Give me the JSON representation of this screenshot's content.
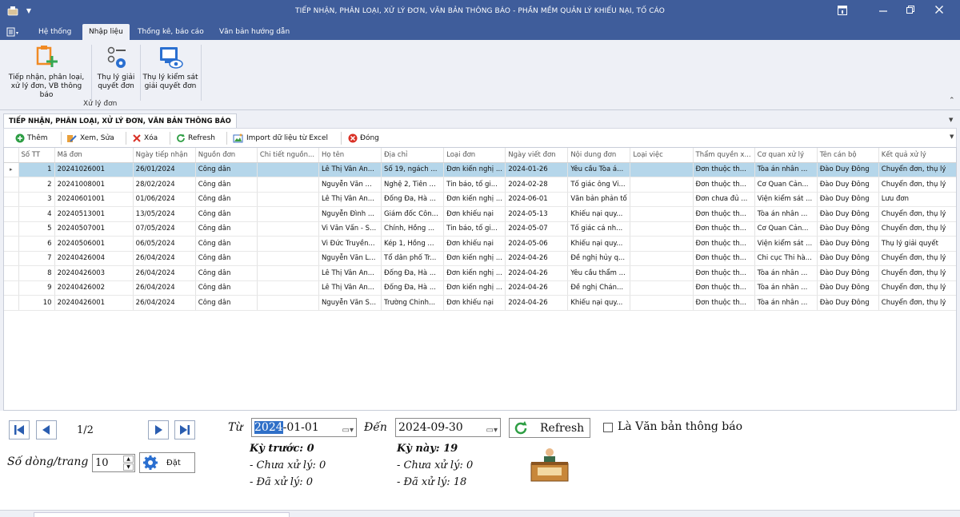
{
  "window": {
    "title": "TIẾP NHẬN, PHÂN LOẠI, XỬ LÝ ĐƠN, VĂN BẢN THÔNG BÁO - PHẦN MỀM QUẢN LÝ KHIẾU NẠI, TỐ CÁO"
  },
  "menu_tabs": [
    "Hệ thống",
    "Nhập liệu",
    "Thống kê, báo cáo",
    "Văn bản hướng dẫn"
  ],
  "ribbon": {
    "buttons": [
      {
        "line1": "Tiếp nhận, phân loại,",
        "line2": "xử lý đơn, VB thông báo",
        "icon": "clipboard-add-icon"
      },
      {
        "line1": "Thụ lý giải",
        "line2": "quyết đơn",
        "icon": "settings-list-icon"
      },
      {
        "line1": "Thụ lý kiểm sát",
        "line2": "giải quyết đơn",
        "icon": "monitor-eye-icon"
      }
    ],
    "group_label": "Xử lý đơn"
  },
  "document_tab": "TIẾP NHẬN, PHÂN LOẠI, XỬ LÝ ĐƠN, VĂN BẢN THÔNG BÁO",
  "toolbar": {
    "add": "Thêm",
    "edit": "Xem, Sửa",
    "delete": "Xóa",
    "refresh": "Refresh",
    "import": "Import dữ liệu từ Excel",
    "close": "Đóng"
  },
  "grid": {
    "columns": [
      "Số TT",
      "Mã đơn",
      "Ngày tiếp nhận",
      "Nguồn đơn",
      "Chi tiết nguồn...",
      "Họ tên",
      "Địa chỉ",
      "Loại đơn",
      "Ngày viết đơn",
      "Nội dung đơn",
      "Loại việc",
      "Thẩm quyền x...",
      "Cơ quan xử lý",
      "Tên cán bộ",
      "Kết quả xử lý"
    ],
    "rows": [
      [
        "1",
        "20241026001",
        "26/01/2024",
        "Công dân",
        "",
        "Lê Thị Vân An...",
        "Số 19, ngách ...",
        "Đơn kiến nghị ...",
        "2024-01-26",
        "Yêu cầu Tòa á...",
        "",
        "Đơn thuộc th...",
        "Tòa án nhân ...",
        "Đào Duy Đông",
        "Chuyển đơn, thụ lý"
      ],
      [
        "2",
        "20241008001",
        "28/02/2024",
        "Công dân",
        "",
        "Nguyễn Văn ...",
        "Nghệ 2, Tiên ...",
        "Tin báo, tố gi...",
        "2024-02-28",
        "Tố giác ông Vi...",
        "",
        "Đơn thuộc th...",
        "Cơ Quan Cản...",
        "Đào Duy Đông",
        "Chuyển đơn, thụ lý"
      ],
      [
        "3",
        "20240601001",
        "01/06/2024",
        "Công dân",
        "",
        "Lê Thị Vân An...",
        "Đống Đa, Hà ...",
        "Đơn kiến nghị ...",
        "2024-06-01",
        "Văn bản phản tố",
        "",
        "Đơn chưa đủ ...",
        "Viện kiểm sát ...",
        "Đào Duy Đông",
        "Lưu đơn"
      ],
      [
        "4",
        "20240513001",
        "13/05/2024",
        "Công dân",
        "",
        "Nguyễn Đình ...",
        "Giám đốc Côn...",
        "Đơn khiếu nại",
        "2024-05-13",
        "Khiếu nại quy...",
        "",
        "Đơn thuộc th...",
        "Tòa án nhân ...",
        "Đào Duy Đông",
        "Chuyển đơn, thụ lý"
      ],
      [
        "5",
        "20240507001",
        "07/05/2024",
        "Công dân",
        "",
        "Vi Văn Vấn - S...",
        "Chính, Hồng ...",
        "Tin báo, tố gi...",
        "2024-05-07",
        "Tố giác cá nh...",
        "",
        "Đơn thuộc th...",
        "Cơ Quan Cản...",
        "Đào Duy Đông",
        "Chuyển đơn, thụ lý"
      ],
      [
        "6",
        "20240506001",
        "06/05/2024",
        "Công dân",
        "",
        "Vi Đức Truyền...",
        "Kép 1, Hồng ...",
        "Đơn khiếu nại",
        "2024-05-06",
        "Khiếu nại quy...",
        "",
        "Đơn thuộc th...",
        "Viện kiểm sát ...",
        "Đào Duy Đông",
        "Thụ lý giải quyết"
      ],
      [
        "7",
        "20240426004",
        "26/04/2024",
        "Công dân",
        "",
        "Nguyễn Văn L...",
        "Tổ dân phố Tr...",
        "Đơn kiến nghị ...",
        "2024-04-26",
        "Đề nghị hủy q...",
        "",
        "Đơn thuộc th...",
        "Chi cục Thi hà...",
        "Đào Duy Đông",
        "Chuyển đơn, thụ lý"
      ],
      [
        "8",
        "20240426003",
        "26/04/2024",
        "Công dân",
        "",
        "Lê Thị Vân An...",
        "Đống Đa, Hà ...",
        "Đơn kiến nghị ...",
        "2024-04-26",
        "Yêu cầu thẩm ...",
        "",
        "Đơn thuộc th...",
        "Tòa án nhân ...",
        "Đào Duy Đông",
        "Chuyển đơn, thụ lý"
      ],
      [
        "9",
        "20240426002",
        "26/04/2024",
        "Công dân",
        "",
        "Lê Thị Vân An...",
        "Đống Đa, Hà ...",
        "Đơn kiến nghị ...",
        "2024-04-26",
        "Đề nghị Chán...",
        "",
        "Đơn thuộc th...",
        "Tòa án nhân ...",
        "Đào Duy Đông",
        "Chuyển đơn, thụ lý"
      ],
      [
        "10",
        "20240426001",
        "26/04/2024",
        "Công dân",
        "",
        "Nguyễn Văn S...",
        "Trường Chinh...",
        "Đơn khiếu nại",
        "2024-04-26",
        "Khiếu nại quy...",
        "",
        "Đơn thuộc th...",
        "Tòa án nhân ...",
        "Đào Duy Đông",
        "Chuyển đơn, thụ lý"
      ]
    ]
  },
  "pager": {
    "page_text": "1/2",
    "rows_per_page_label": "Số dòng/trang",
    "rows_per_page_value": "10",
    "apply_label": "Đặt"
  },
  "filter": {
    "from_label": "Từ",
    "from_year": "2024",
    "from_rest": "-01-01",
    "to_label": "Đến",
    "to_value": "2024-09-30",
    "refresh_label": "Refresh",
    "notice_checkbox_label": "Là Văn bản thông báo"
  },
  "summary": {
    "prev_title": "Kỳ trước: 0",
    "prev_pending": "- Chưa xử lý: 0",
    "prev_done": "- Đã xử lý: 0",
    "curr_title": "Kỳ này: 19",
    "curr_pending": "- Chưa xử lý: 0",
    "curr_done": "- Đã xử lý: 18"
  },
  "colors": {
    "title_bar": "#3f5d9b",
    "selected_row": "#b5d6ea",
    "nav_blue": "#2a5db0"
  }
}
